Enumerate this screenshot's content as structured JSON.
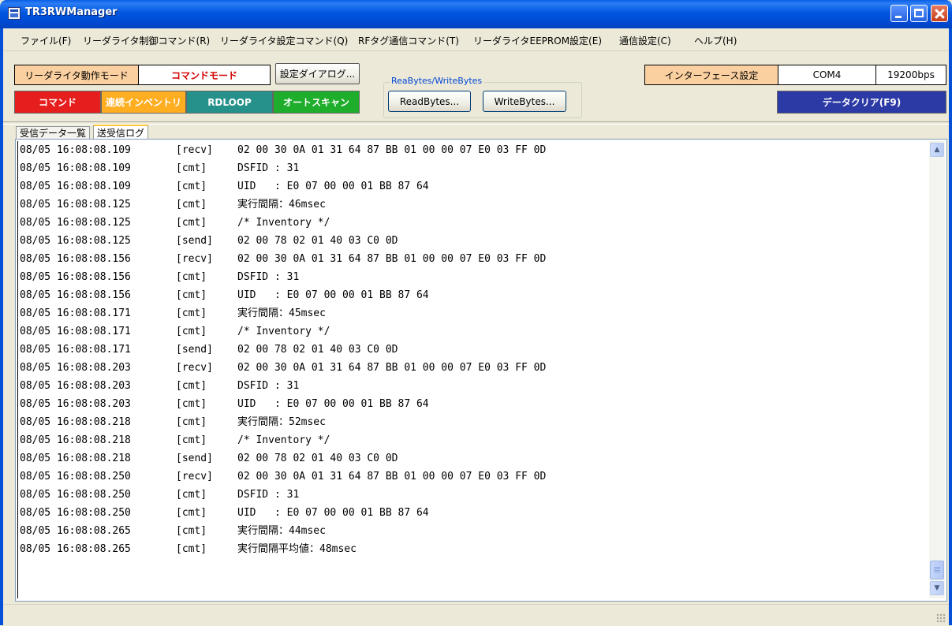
{
  "window": {
    "title": "TR3RWManager"
  },
  "menu": [
    "ファイル(F)",
    "リーダライタ制御コマンド(R)",
    "リーダライタ設定コマンド(Q)",
    "RFタグ通信コマンド(T)",
    "リーダライタEEPROM設定(E)",
    "通信設定(C)",
    "ヘルプ(H)"
  ],
  "toolbar": {
    "mode_label": "リーダライタ動作モード",
    "mode_value": "コマンドモード",
    "settings_dialog": "設定ダイアログ...",
    "group_title": "ReaBytes/WriteBytes",
    "read_bytes": "ReadBytes...",
    "write_bytes": "WriteBytes...",
    "interface_label": "インターフェース設定",
    "com_port": "COM4",
    "baud_rate": "19200bps",
    "command": "コマンド",
    "continuous_inventory": "連続インベントリ",
    "rdloop": "RDLOOP",
    "auto_scan": "オートスキャン",
    "data_clear": "データクリア(F9)"
  },
  "colors": {
    "command": "#e61e1e",
    "continuous_inventory": "#ffae22",
    "rdloop": "#26908a",
    "auto_scan": "#1fad2c",
    "data_clear": "#2c3aa5",
    "mode_value_text": "#d40000",
    "mode_label_bg": "#fbd0a0"
  },
  "tabs": [
    {
      "label": "受信データ一覧",
      "active": false
    },
    {
      "label": "送受信ログ",
      "active": true
    }
  ],
  "log": [
    {
      "time": "08/05 16:08:08.109",
      "tag": "[recv]",
      "msg": "02 00 30 0A 01 31 64 87 BB 01 00 00 07 E0 03 FF 0D"
    },
    {
      "time": "08/05 16:08:08.109",
      "tag": "[cmt]",
      "msg": "DSFID : 31"
    },
    {
      "time": "08/05 16:08:08.109",
      "tag": "[cmt]",
      "msg": "UID   : E0 07 00 00 01 BB 87 64"
    },
    {
      "time": "08/05 16:08:08.125",
      "tag": "[cmt]",
      "msg": "実行間隔：46msec"
    },
    {
      "time": "08/05 16:08:08.125",
      "tag": "[cmt]",
      "msg": "/* Inventory */"
    },
    {
      "time": "08/05 16:08:08.125",
      "tag": "[send]",
      "msg": "02 00 78 02 01 40 03 C0 0D"
    },
    {
      "time": "08/05 16:08:08.156",
      "tag": "[recv]",
      "msg": "02 00 30 0A 01 31 64 87 BB 01 00 00 07 E0 03 FF 0D"
    },
    {
      "time": "08/05 16:08:08.156",
      "tag": "[cmt]",
      "msg": "DSFID : 31"
    },
    {
      "time": "08/05 16:08:08.156",
      "tag": "[cmt]",
      "msg": "UID   : E0 07 00 00 01 BB 87 64"
    },
    {
      "time": "08/05 16:08:08.171",
      "tag": "[cmt]",
      "msg": "実行間隔：45msec"
    },
    {
      "time": "08/05 16:08:08.171",
      "tag": "[cmt]",
      "msg": "/* Inventory */"
    },
    {
      "time": "08/05 16:08:08.171",
      "tag": "[send]",
      "msg": "02 00 78 02 01 40 03 C0 0D"
    },
    {
      "time": "08/05 16:08:08.203",
      "tag": "[recv]",
      "msg": "02 00 30 0A 01 31 64 87 BB 01 00 00 07 E0 03 FF 0D"
    },
    {
      "time": "08/05 16:08:08.203",
      "tag": "[cmt]",
      "msg": "DSFID : 31"
    },
    {
      "time": "08/05 16:08:08.203",
      "tag": "[cmt]",
      "msg": "UID   : E0 07 00 00 01 BB 87 64"
    },
    {
      "time": "08/05 16:08:08.218",
      "tag": "[cmt]",
      "msg": "実行間隔：52msec"
    },
    {
      "time": "08/05 16:08:08.218",
      "tag": "[cmt]",
      "msg": "/* Inventory */"
    },
    {
      "time": "08/05 16:08:08.218",
      "tag": "[send]",
      "msg": "02 00 78 02 01 40 03 C0 0D"
    },
    {
      "time": "08/05 16:08:08.250",
      "tag": "[recv]",
      "msg": "02 00 30 0A 01 31 64 87 BB 01 00 00 07 E0 03 FF 0D"
    },
    {
      "time": "08/05 16:08:08.250",
      "tag": "[cmt]",
      "msg": "DSFID : 31"
    },
    {
      "time": "08/05 16:08:08.250",
      "tag": "[cmt]",
      "msg": "UID   : E0 07 00 00 01 BB 87 64"
    },
    {
      "time": "08/05 16:08:08.265",
      "tag": "[cmt]",
      "msg": "実行間隔：44msec"
    },
    {
      "time": "08/05 16:08:08.265",
      "tag": "[cmt]",
      "msg": "実行間隔平均値：48msec"
    }
  ]
}
